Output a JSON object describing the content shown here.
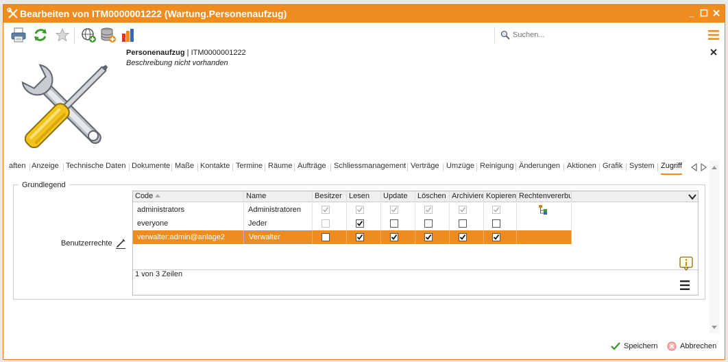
{
  "window": {
    "title": "Bearbeiten von ITM0000001222 (Wartung.Personenaufzug)",
    "accent": "#ef8c1f"
  },
  "toolbar": {
    "icons": [
      "print-icon",
      "refresh-icon",
      "favorite-star-icon",
      "add-globe-icon",
      "add-database-icon",
      "chart-tools-icon"
    ],
    "search_placeholder": "Suchen..."
  },
  "header": {
    "type_name": "Personenaufzug",
    "separator": "|",
    "object_id": "ITM0000001222",
    "description": "Beschreibung nicht vorhanden"
  },
  "tabs": [
    {
      "label": "aften"
    },
    {
      "label": "Anzeige"
    },
    {
      "label": "Technische Daten"
    },
    {
      "label": "Dokumente"
    },
    {
      "label": "Maße"
    },
    {
      "label": "Kontakte"
    },
    {
      "label": "Termine"
    },
    {
      "label": "Räume"
    },
    {
      "label": "Aufträge"
    },
    {
      "label": "Schliessmanagement"
    },
    {
      "label": "Verträge"
    },
    {
      "label": "Umzüge"
    },
    {
      "label": "Reinigung"
    },
    {
      "label": "Änderungen"
    },
    {
      "label": "Aktionen"
    },
    {
      "label": "Grafik"
    },
    {
      "label": "System"
    },
    {
      "label": "Zugriff",
      "active": true
    }
  ],
  "section": {
    "legend": "Grundlegend",
    "field_label": "Benutzerrechte"
  },
  "grid": {
    "columns": [
      "Code",
      "Name",
      "Besitzer",
      "Lesen",
      "Update",
      "Löschen",
      "Archivieren",
      "Kopieren",
      "Rechtenvererbung"
    ],
    "rows": [
      {
        "code": "administrators",
        "name": "Administratoren",
        "checks": [
          true,
          true,
          true,
          true,
          true,
          true
        ],
        "disabled": true,
        "inheritance_icon": true,
        "selected": false
      },
      {
        "code": "everyone",
        "name": "Jeder",
        "checks": [
          false,
          true,
          false,
          false,
          false,
          false
        ],
        "disabled": false,
        "owner_disabled": true,
        "inheritance_icon": false,
        "selected": false
      },
      {
        "code": "verwalter:admin@anlage2",
        "name": "Verwalter",
        "checks": [
          false,
          true,
          true,
          true,
          true,
          true
        ],
        "disabled": false,
        "inheritance_icon": false,
        "selected": true
      }
    ],
    "row_count": "1 von 3 Zeilen"
  },
  "footer": {
    "save": "Speichern",
    "cancel": "Abbrechen"
  }
}
